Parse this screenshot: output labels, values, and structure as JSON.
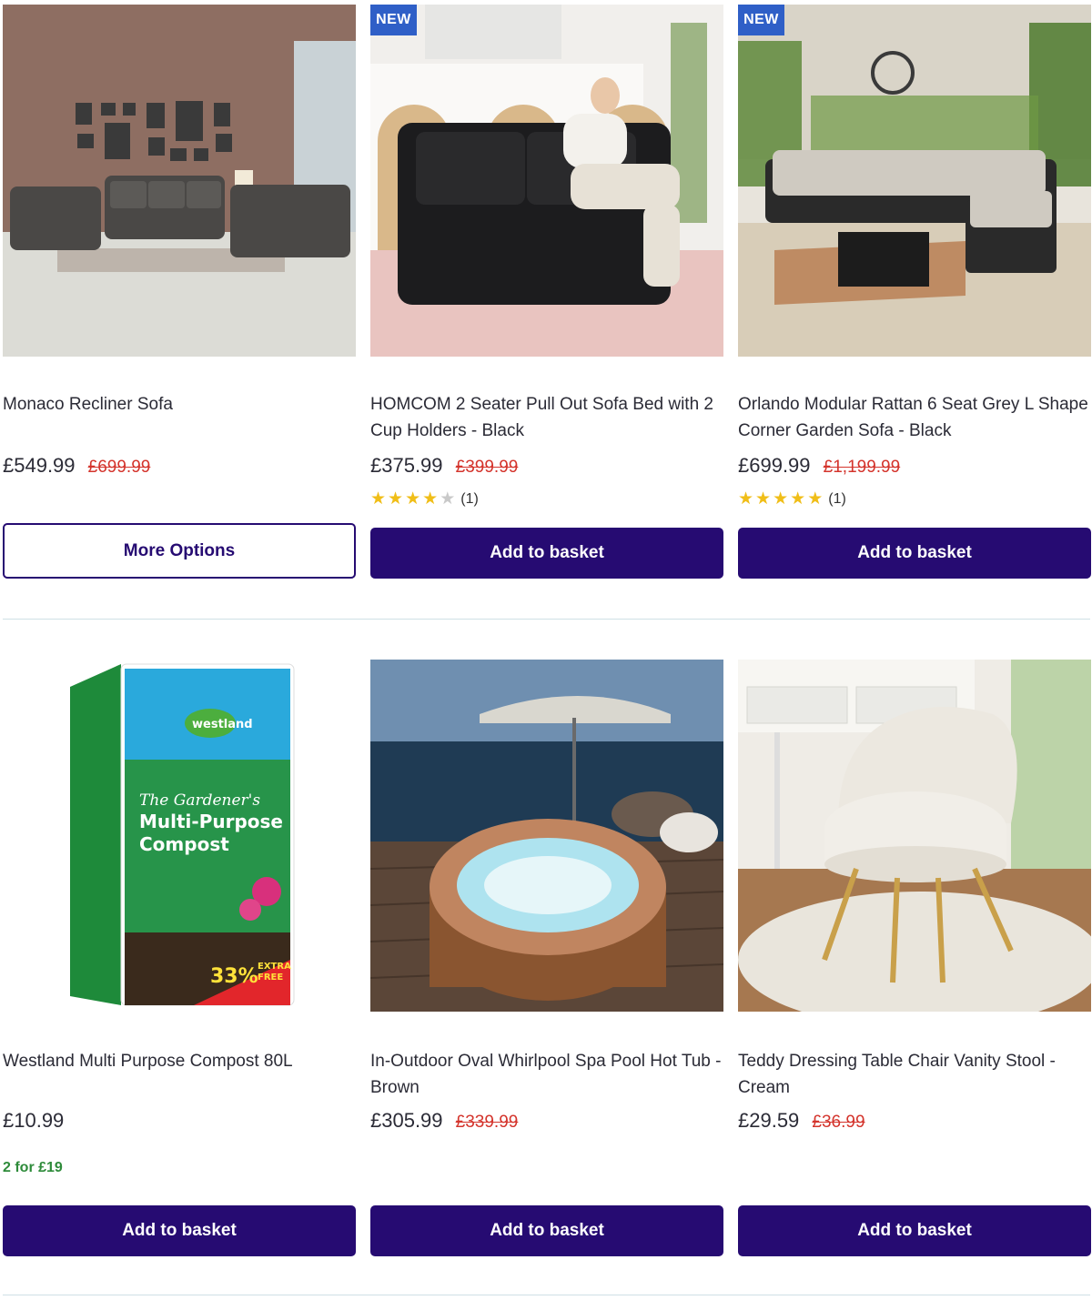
{
  "products": [
    {
      "badge": "",
      "title": "Monaco Recliner Sofa",
      "price": "£549.99",
      "was_price": "£699.99",
      "button": "More Options",
      "image_icon": "recliner-sofa-set-photo"
    },
    {
      "badge": "NEW",
      "title": "HOMCOM 2 Seater Pull Out Sofa Bed with 2 Cup Holders - Black",
      "price": "£375.99",
      "was_price": "£399.99",
      "rating": 4,
      "rating_count": "(1)",
      "button": "Add to basket",
      "image_icon": "black-sofa-bed-photo"
    },
    {
      "badge": "NEW",
      "title": "Orlando Modular Rattan 6 Seat Grey L Shape Corner Garden Sofa - Black",
      "price": "£699.99",
      "was_price": "£1,199.99",
      "rating": 5,
      "rating_count": "(1)",
      "button": "Add to basket",
      "image_icon": "rattan-garden-sofa-photo"
    },
    {
      "badge": "",
      "title": "Westland Multi Purpose Compost 80L",
      "price": "£10.99",
      "offer": "2 for £19",
      "button": "Add to basket",
      "image_icon": "compost-bag-photo",
      "packshot": {
        "brand": "westland",
        "line1": "The Gardener's",
        "line2": "Multi-Purpose",
        "line3": "Compost",
        "promo": "33%",
        "promo_extra": "EXTRA",
        "promo_free": "FREE"
      }
    },
    {
      "badge": "",
      "title": "In-Outdoor Oval Whirlpool Spa Pool Hot Tub - Brown",
      "price": "£305.99",
      "was_price": "£339.99",
      "button": "Add to basket",
      "image_icon": "hot-tub-photo"
    },
    {
      "badge": "",
      "title": "Teddy Dressing Table Chair Vanity Stool - Cream",
      "price": "£29.59",
      "was_price": "£36.99",
      "button": "Add to basket",
      "image_icon": "vanity-stool-photo"
    }
  ],
  "colors": {
    "primary_button": "#260b72",
    "was_price": "#d4342c",
    "offer": "#2e8b3a",
    "badge": "#2f5fc7",
    "star": "#f0be18"
  }
}
